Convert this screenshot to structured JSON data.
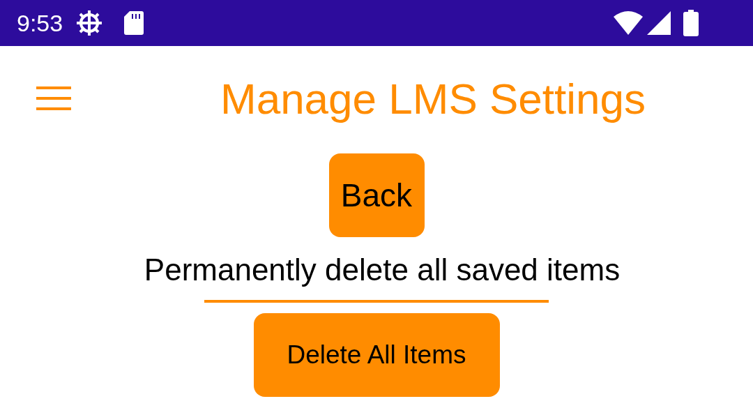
{
  "status_bar": {
    "time": "9:53"
  },
  "header": {
    "title": "Manage LMS Settings"
  },
  "back_button": {
    "label": "Back"
  },
  "description": "Permanently delete all saved items",
  "delete_button": {
    "label": "Delete All Items"
  }
}
